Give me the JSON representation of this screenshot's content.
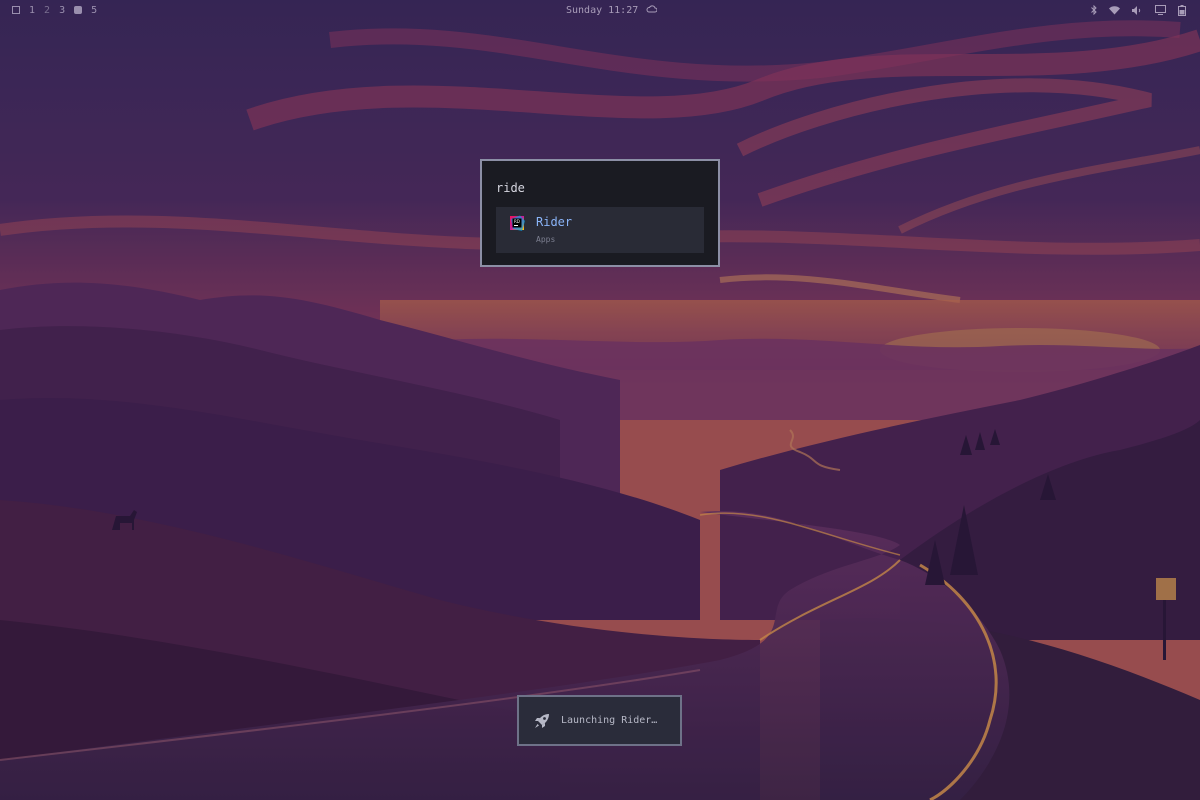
{
  "topbar": {
    "workspaces": [
      "1",
      "2",
      "3",
      "5"
    ],
    "clock": "Sunday 11:27",
    "icons": [
      "layout-icon",
      "cloud-icon",
      "bluetooth-icon",
      "wifi-icon",
      "volume-icon",
      "display-icon",
      "battery-icon"
    ]
  },
  "launcher": {
    "query": "ride",
    "results": [
      {
        "name": "Rider",
        "category": "Apps",
        "icon": "rider-app-icon"
      }
    ],
    "accent": "#8ab4f8",
    "border": "#8c8fa6"
  },
  "notification": {
    "text": "Launching Rider…",
    "icon": "rocket-icon"
  }
}
